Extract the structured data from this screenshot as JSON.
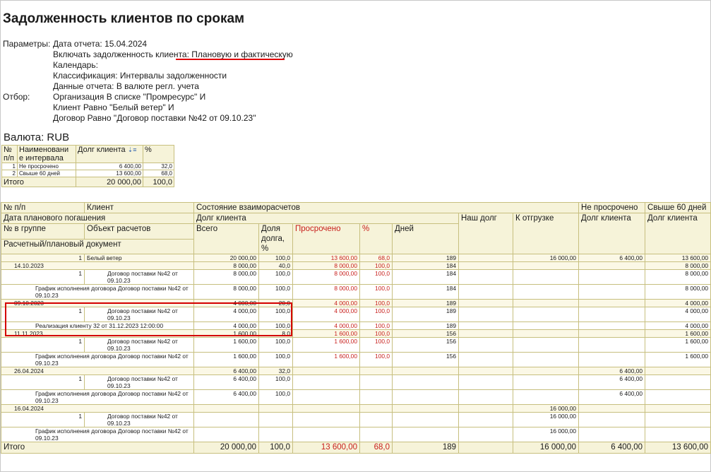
{
  "report": {
    "title": "Задолженность клиентов по срокам",
    "params_label": "Параметры:",
    "params": [
      "Дата отчета: 15.04.2024",
      "Включать задолженность клиента: Плановую и фактическую",
      "Календарь:",
      "Классификация: Интервалы задолженности",
      "Данные отчета: В валюте регл. учета"
    ],
    "filter_label": "Отбор:",
    "filters": [
      "Организация В списке \"Промресурс\" И",
      "Клиент Равно \"Белый ветер\" И",
      "Договор Равно \"Договор поставки №42 от 09.10.23\""
    ],
    "currency": "Валюта: RUB"
  },
  "summary": {
    "headers": [
      "№ п/п",
      "Наименовани е интервала",
      "Долг клиента",
      "%"
    ],
    "rows": [
      {
        "n": "1",
        "name": "Не просрочено",
        "debt": "6 400,00",
        "pct": "32,0"
      },
      {
        "n": "2",
        "name": "Свыше 60 дней",
        "debt": "13 600,00",
        "pct": "68,0"
      }
    ],
    "total": {
      "label": "Итого",
      "debt": "20 000,00",
      "pct": "100,0"
    }
  },
  "main": {
    "h1": {
      "np": "№ п/п",
      "client": "Клиент",
      "state": "Состояние взаиморасчетов",
      "notdue": "Не просрочено",
      "over60": "Свыше 60 дней"
    },
    "h2": {
      "date": "Дата планового погашения",
      "debt": "Долг клиента",
      "ourdebt": "Наш долг",
      "toship": "К отгрузке",
      "notdue_debt": "Долг клиента",
      "over60_debt": "Долг клиента"
    },
    "h3": {
      "ingroup": "№ в группе",
      "object": "Объект расчетов",
      "total": "Всего",
      "share": "Доля долга, %",
      "overdue": "Просрочено",
      "pct": "%",
      "days": "Дней"
    },
    "h4": {
      "doc": "Расчетный/плановый документ"
    },
    "client_row": {
      "n": "1",
      "name": "Белый ветер",
      "total": "20 000,00",
      "share": "100,0",
      "overdue": "13 600,00",
      "pct": "68,0",
      "days": "189",
      "toship": "16 000,00",
      "notdue": "6 400,00",
      "over60": "13 600,00"
    },
    "groups": [
      {
        "date": "14.10.2023",
        "total": "8 000,00",
        "share": "40,0",
        "overdue": "8 000,00",
        "pct": "100,0",
        "days": "184",
        "ourdebt": "",
        "toship": "",
        "notdue": "",
        "over60": "8 000,00",
        "items": [
          {
            "n": "1",
            "object": "Договор поставки №42 от 09.10.23",
            "total": "8 000,00",
            "share": "100,0",
            "overdue": "8 000,00",
            "pct": "100,0",
            "days": "184",
            "toship": "",
            "notdue": "",
            "over60": "8 000,00",
            "doc": "График исполнения договора Договор поставки №42 от 09.10.23",
            "doc_total": "8 000,00",
            "doc_share": "100,0",
            "doc_overdue": "8 000,00",
            "doc_pct": "100,0",
            "doc_days": "184",
            "doc_toship": "",
            "doc_notdue": "",
            "doc_over60": "8 000,00"
          }
        ]
      },
      {
        "date": "09.10.2023",
        "total": "4 000,00",
        "share": "20,0",
        "overdue": "4 000,00",
        "pct": "100,0",
        "days": "189",
        "ourdebt": "",
        "toship": "",
        "notdue": "",
        "over60": "4 000,00",
        "items": [
          {
            "n": "1",
            "object": "Договор поставки №42 от 09.10.23",
            "total": "4 000,00",
            "share": "100,0",
            "overdue": "4 000,00",
            "pct": "100,0",
            "days": "189",
            "toship": "",
            "notdue": "",
            "over60": "4 000,00",
            "doc": "Реализация клиенту 32 от 31.12.2023 12:00:00",
            "doc_total": "4 000,00",
            "doc_share": "100,0",
            "doc_overdue": "4 000,00",
            "doc_pct": "100,0",
            "doc_days": "189",
            "doc_toship": "",
            "doc_notdue": "",
            "doc_over60": "4 000,00"
          }
        ]
      },
      {
        "date": "11.11.2023",
        "total": "1 600,00",
        "share": "8,0",
        "overdue": "1 600,00",
        "pct": "100,0",
        "days": "156",
        "ourdebt": "",
        "toship": "",
        "notdue": "",
        "over60": "1 600,00",
        "items": [
          {
            "n": "1",
            "object": "Договор поставки №42 от 09.10.23",
            "total": "1 600,00",
            "share": "100,0",
            "overdue": "1 600,00",
            "pct": "100,0",
            "days": "156",
            "toship": "",
            "notdue": "",
            "over60": "1 600,00",
            "doc": "График исполнения договора Договор поставки №42 от 09.10.23",
            "doc_total": "1 600,00",
            "doc_share": "100,0",
            "doc_overdue": "1 600,00",
            "doc_pct": "100,0",
            "doc_days": "156",
            "doc_toship": "",
            "doc_notdue": "",
            "doc_over60": "1 600,00"
          }
        ]
      },
      {
        "date": "26.04.2024",
        "total": "6 400,00",
        "share": "32,0",
        "overdue": "",
        "pct": "",
        "days": "",
        "ourdebt": "",
        "toship": "",
        "notdue": "6 400,00",
        "over60": "",
        "items": [
          {
            "n": "1",
            "object": "Договор поставки №42 от 09.10.23",
            "total": "6 400,00",
            "share": "100,0",
            "overdue": "",
            "pct": "",
            "days": "",
            "toship": "",
            "notdue": "6 400,00",
            "over60": "",
            "doc": "График исполнения договора Договор поставки №42 от 09.10.23",
            "doc_total": "6 400,00",
            "doc_share": "100,0",
            "doc_overdue": "",
            "doc_pct": "",
            "doc_days": "",
            "doc_toship": "",
            "doc_notdue": "6 400,00",
            "doc_over60": ""
          }
        ]
      },
      {
        "date": "16.04.2024",
        "total": "",
        "share": "",
        "overdue": "",
        "pct": "",
        "days": "",
        "ourdebt": "",
        "toship": "16 000,00",
        "notdue": "",
        "over60": "",
        "items": [
          {
            "n": "1",
            "object": "Договор поставки №42 от 09.10.23",
            "total": "",
            "share": "",
            "overdue": "",
            "pct": "",
            "days": "",
            "toship": "16 000,00",
            "notdue": "",
            "over60": "",
            "doc": "График исполнения договора Договор поставки №42 от 09.10.23",
            "doc_total": "",
            "doc_share": "",
            "doc_overdue": "",
            "doc_pct": "",
            "doc_days": "",
            "doc_toship": "16 000,00",
            "doc_notdue": "",
            "doc_over60": ""
          }
        ]
      }
    ],
    "total": {
      "label": "Итого",
      "total": "20 000,00",
      "share": "100,0",
      "overdue": "13 600,00",
      "pct": "68,0",
      "days": "189",
      "toship": "16 000,00",
      "notdue": "6 400,00",
      "over60": "13 600,00"
    }
  },
  "colors": {
    "header_bg": "#f6f3d9",
    "grid": "#c7bf7f",
    "overdue_text": "#c8201d",
    "highlight": "#d40000"
  }
}
